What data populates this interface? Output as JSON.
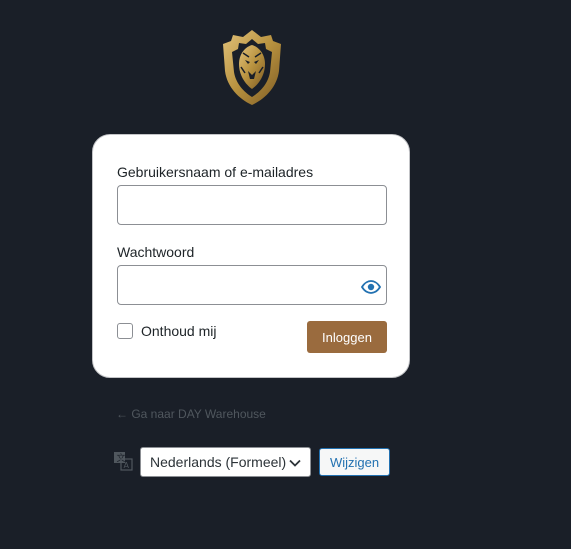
{
  "login_form": {
    "username_label": "Gebruikersnaam of e-mailadres",
    "username_value": "",
    "password_label": "Wachtwoord",
    "password_value": "",
    "remember_label": "Onthoud mij",
    "remember_checked": false,
    "submit_label": "Inloggen"
  },
  "links": {
    "back_to_site": "← Ga naar DAY Warehouse"
  },
  "language": {
    "selected": "Nederlands (Formeel)",
    "change_button": "Wijzigen"
  },
  "colors": {
    "background": "#1a1f28",
    "brand_gold": "#b8923f",
    "button_brown": "#9a6b3e",
    "link_blue": "#2271b1"
  },
  "icons": {
    "logo": "lion-shield-logo",
    "show_password": "eye-icon",
    "language": "translate-icon",
    "select_arrow": "chevron-down-icon"
  }
}
